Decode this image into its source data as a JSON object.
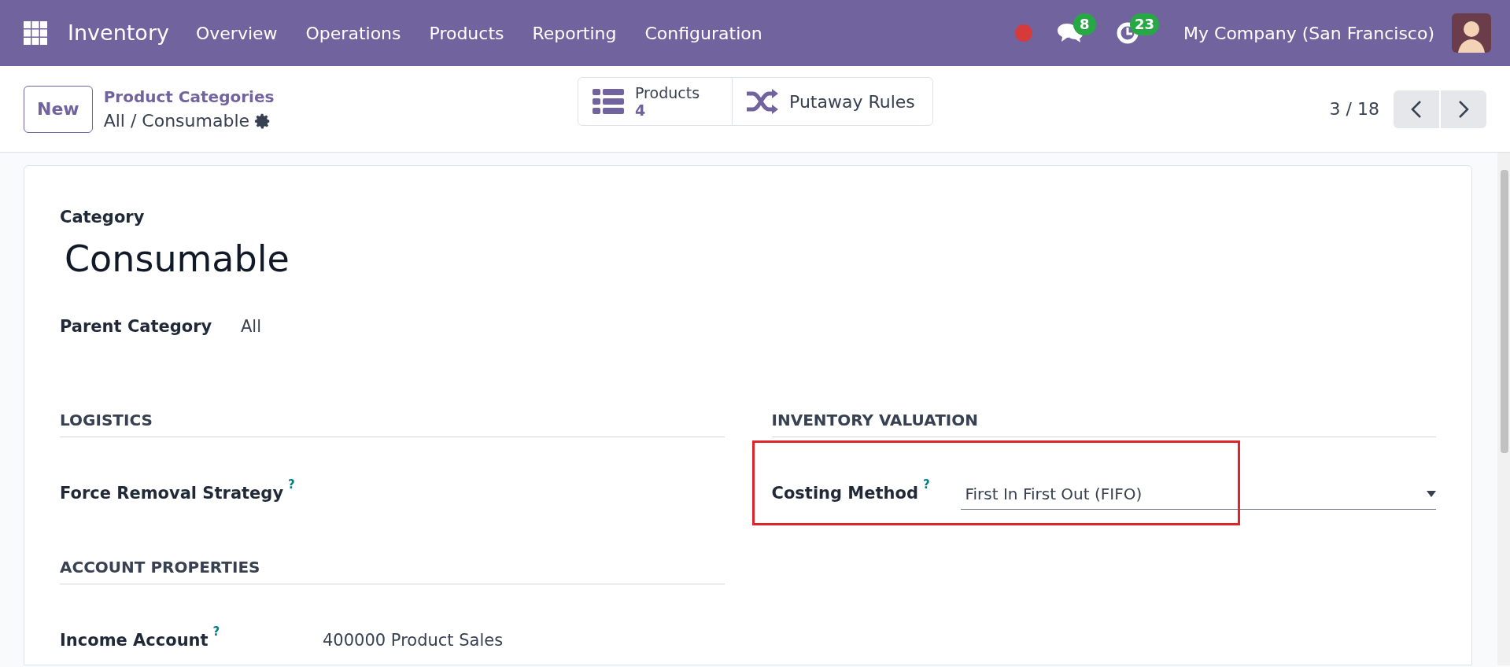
{
  "navbar": {
    "app": "Inventory",
    "menu": [
      "Overview",
      "Operations",
      "Products",
      "Reporting",
      "Configuration"
    ],
    "messages_badge": "8",
    "activities_badge": "23",
    "company": "My Company (San Francisco)"
  },
  "control_panel": {
    "new_button": "New",
    "breadcrumb": "Product Categories",
    "record_path": "All / Consumable",
    "smart_buttons": [
      {
        "kind": "count",
        "label": "Products",
        "value": "4"
      },
      {
        "kind": "plain",
        "label": "Putaway Rules"
      }
    ],
    "pager": "3 / 18"
  },
  "form": {
    "category_label": "Category",
    "name": "Consumable",
    "parent_label": "Parent Category",
    "parent_value": "All",
    "sections": [
      {
        "title": "LOGISTICS",
        "fields": [
          {
            "label": "Force Removal Strategy",
            "help": "?",
            "kind": "empty"
          }
        ]
      },
      {
        "title": "INVENTORY VALUATION",
        "fields": [
          {
            "label": "Costing Method",
            "help": "?",
            "kind": "select",
            "value": "First In First Out (FIFO)",
            "highlighted": true
          }
        ]
      },
      {
        "title": "ACCOUNT PROPERTIES",
        "fields": [
          {
            "label": "Income Account",
            "help": "?",
            "kind": "text",
            "value": "400000 Product Sales"
          }
        ]
      }
    ]
  }
}
